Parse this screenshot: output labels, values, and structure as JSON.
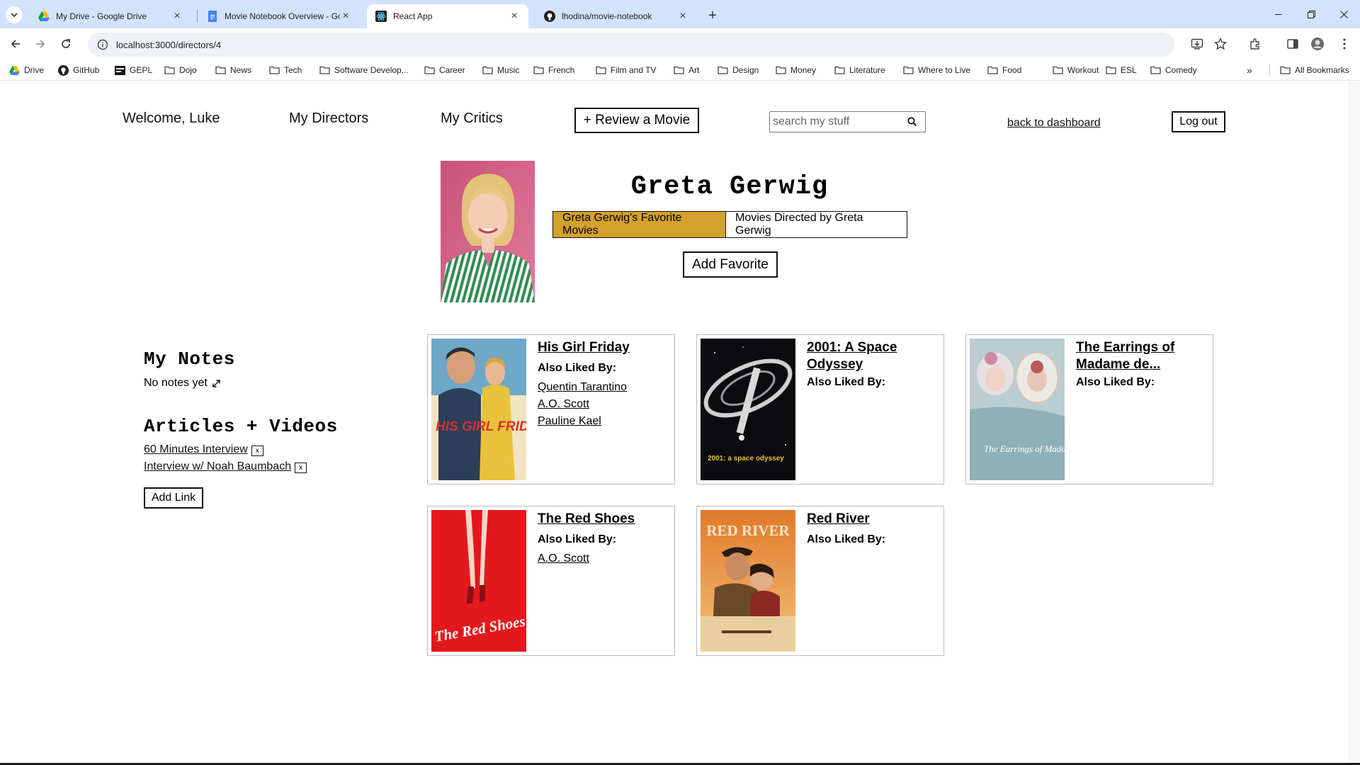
{
  "browser": {
    "tabs": [
      {
        "title": "My Drive - Google Drive",
        "icon": "google-drive-icon",
        "active": false
      },
      {
        "title": "Movie Notebook Overview - Go",
        "icon": "google-docs-icon",
        "active": false
      },
      {
        "title": "React App",
        "icon": "react-icon",
        "active": true
      },
      {
        "title": "lhodina/movie-notebook",
        "icon": "github-icon",
        "active": false
      }
    ],
    "url": "localhost:3000/directors/4",
    "bookmarks": [
      "Drive",
      "GitHub",
      "GEPL",
      "Dojo",
      "News",
      "Tech",
      "Software Develop...",
      "Career",
      "Music",
      "French",
      "Film and TV",
      "Art",
      "Design",
      "Money",
      "Literature",
      "Where to Live",
      "Food",
      "Workout",
      "ESL",
      "Comedy"
    ],
    "all_bookmarks": "All Bookmarks",
    "overflow": "»"
  },
  "nav": {
    "welcome": "Welcome, Luke",
    "directors": "My Directors",
    "critics": "My Critics",
    "review_button": "+ Review a Movie",
    "search_placeholder": "search my stuff",
    "back_link": "back to dashboard",
    "logout": "Log out"
  },
  "director": {
    "name": "Greta Gerwig",
    "tab_favorites": "Greta Gerwig's Favorite Movies",
    "tab_directed": "Movies Directed by Greta Gerwig",
    "add_favorite": "Add Favorite"
  },
  "notes": {
    "title": "My Notes",
    "empty_text": "No notes yet"
  },
  "articles": {
    "title": "Articles + Videos",
    "items": [
      "60 Minutes Interview",
      "Interview w/ Noah Baumbach"
    ],
    "remove_label": "x",
    "add_link": "Add Link"
  },
  "movies": [
    {
      "title": "His Girl Friday",
      "liked_label": "Also Liked By:",
      "critics": [
        "Quentin Tarantino",
        "A.O. Scott",
        "Pauline Kael"
      ],
      "poster_text": "HIS GIRL FRIDAY"
    },
    {
      "title": "2001: A Space Odyssey",
      "liked_label": "Also Liked By:",
      "critics": [],
      "poster_text": "2001: a space odyssey"
    },
    {
      "title": "The Earrings of Madame de...",
      "liked_label": "Also Liked By:",
      "critics": [],
      "poster_text": "The Earrings of Madame de"
    },
    {
      "title": "The Red Shoes",
      "liked_label": "Also Liked By:",
      "critics": [
        "A.O. Scott"
      ],
      "poster_text": "The Red Shoes"
    },
    {
      "title": "Red River",
      "liked_label": "Also Liked By:",
      "critics": [],
      "poster_text": "RED RIVER"
    }
  ],
  "colors": {
    "tabbar": "#d3e3fd",
    "active_toggle": "#d4a12a"
  }
}
